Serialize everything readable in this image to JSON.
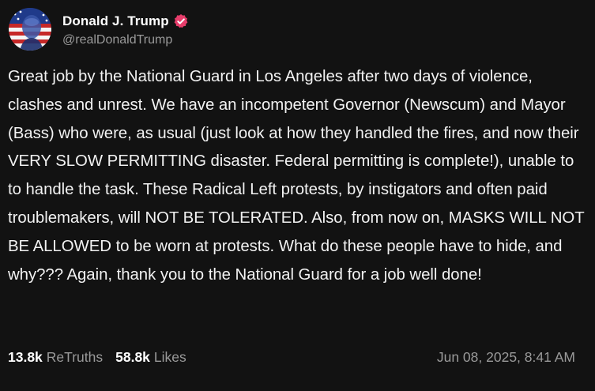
{
  "author": {
    "display_name": "Donald J. Trump",
    "handle": "@realDonaldTrump",
    "verified_color": "#e63d6b"
  },
  "post": {
    "text": "Great job by the National Guard in Los Angeles after two days of violence, clashes and unrest. We have an incompetent Governor (Newscum) and Mayor (Bass) who were, as usual (just look at how they handled the fires, and now their VERY SLOW PERMITTING disaster. Federal permitting is complete!), unable to to handle the task. These Radical Left protests, by instigators and often paid troublemakers, will NOT BE TOLERATED. Also, from now on, MASKS WILL NOT BE ALLOWED to be worn at protests. What do these people have to hide, and why??? Again, thank you to the National Guard for a job well done!"
  },
  "stats": {
    "retruths_count": "13.8k",
    "retruths_label": "ReTruths",
    "likes_count": "58.8k",
    "likes_label": "Likes",
    "timestamp": "Jun 08, 2025, 8:41 AM"
  },
  "theme": {
    "background": "#121212",
    "text": "#f2f2f2",
    "muted": "#9a9a9a"
  }
}
